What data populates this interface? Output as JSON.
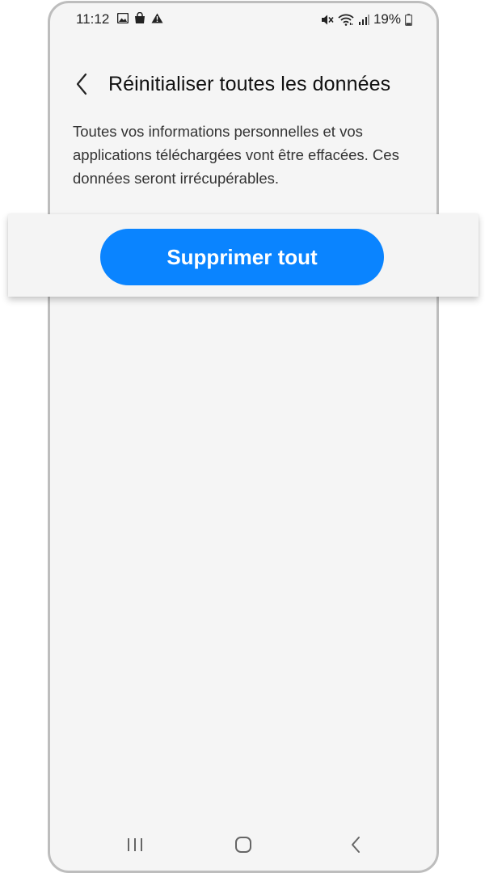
{
  "status_bar": {
    "time": "11:12",
    "battery": "19%",
    "left_icons": [
      "image-icon",
      "shopping-bag-icon",
      "warning-icon"
    ],
    "right_icons": [
      "mute-icon",
      "wifi-icon",
      "signal-icon",
      "battery-icon"
    ]
  },
  "header": {
    "title": "Réinitialiser toutes les données",
    "back_icon": "chevron-left-icon"
  },
  "description": "Toutes vos informations personnelles et vos applications téléchargées vont être effacées. Ces données seront irrécupérables.",
  "action": {
    "delete_label": "Supprimer tout",
    "button_color": "#0a84ff"
  },
  "nav_bar": {
    "icons": [
      "recents-icon",
      "home-icon",
      "back-icon"
    ]
  },
  "colors": {
    "background": "#f5f5f5",
    "frame": "#bdbdbd",
    "accent": "#0a84ff"
  }
}
